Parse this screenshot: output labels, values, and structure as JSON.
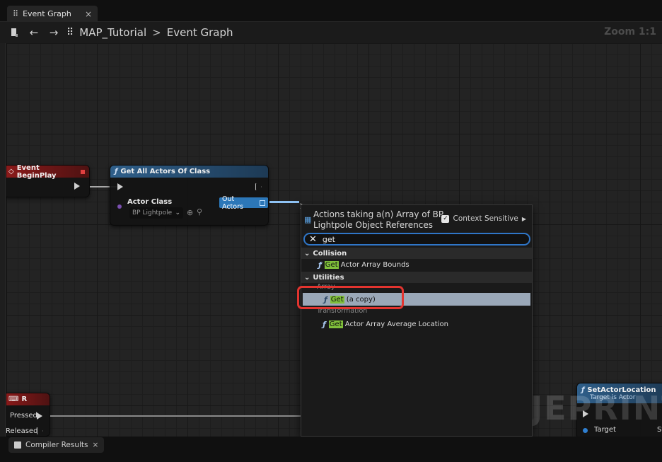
{
  "tab": {
    "label": "Event Graph",
    "close": "×"
  },
  "breadcrumb": {
    "map": "MAP_Tutorial",
    "separator": ">",
    "graph": "Event Graph"
  },
  "zoom": "Zoom 1:1",
  "nodes": {
    "begin_play": {
      "title": "Event BeginPlay"
    },
    "get_all_actors": {
      "title": "Get All Actors Of Class",
      "actor_class_label": "Actor Class",
      "actor_class_value": "BP Lightpole",
      "out_label": "Out Actors"
    },
    "input_r": {
      "title": "R",
      "pressed": "Pressed",
      "released": "Released"
    },
    "set_actor_location": {
      "title": "SetActorLocation",
      "subtitle": "Target is Actor",
      "target": "Target",
      "extra": "Sv"
    }
  },
  "menu": {
    "title": "Actions taking a(n) Array of BP Lightpole Object References",
    "context_sensitive": "Context Sensitive",
    "search_value": "get",
    "categories": [
      {
        "label": "Collision"
      },
      {
        "label": "Utilities"
      }
    ],
    "subcategories": {
      "array": "Array",
      "transformation": "Transformation"
    },
    "items": [
      {
        "highlight": "Get",
        "rest": " Actor Array Bounds"
      },
      {
        "highlight": "Get",
        "rest": " (a copy)"
      },
      {
        "highlight": "Get",
        "rest": " Actor Array Average Location"
      }
    ]
  },
  "bottom_tab": {
    "label": "Compiler Results",
    "close": "×"
  },
  "watermark": "JEPRINT",
  "colors": {
    "event_node": "#8c1a1a",
    "function_node": "#2f5f8a",
    "search_highlight": "#7fbf3a",
    "annotation": "#e3342f"
  }
}
